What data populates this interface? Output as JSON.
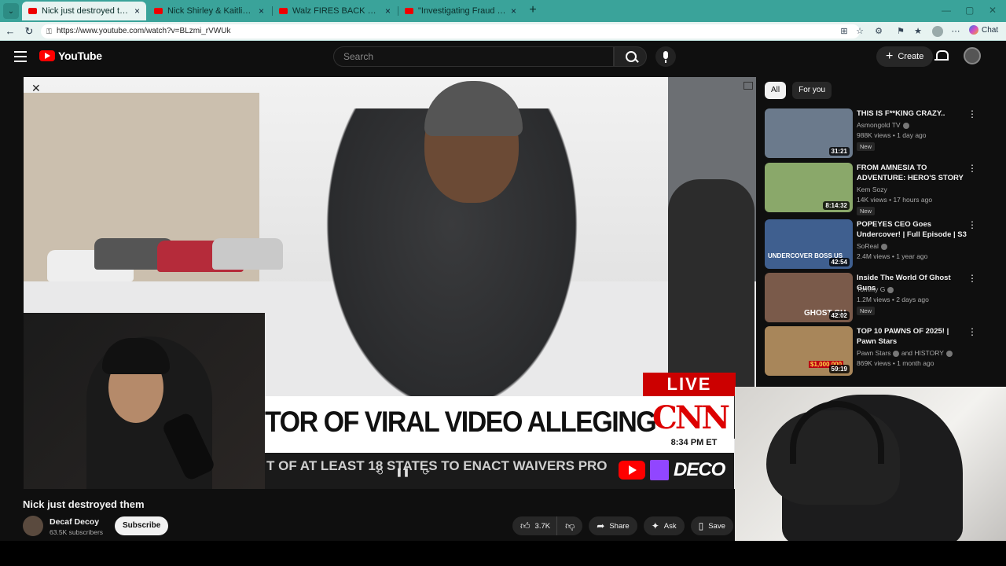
{
  "browser": {
    "tabs": [
      {
        "title": "Nick just destroyed them - YouTube",
        "active": true
      },
      {
        "title": "Nick Shirley & Kaitlin Bennett vs. F",
        "active": false
      },
      {
        "title": "Walz FIRES BACK after Trump team",
        "active": false
      },
      {
        "title": "\"Investigating Fraud Is WHITE SUP",
        "active": false
      }
    ],
    "url": "https://www.youtube.com/watch?v=BLzmi_rVWUk",
    "chat_label": "Chat"
  },
  "youtube": {
    "logo_text": "YouTube",
    "search_placeholder": "Search",
    "create_label": "Create"
  },
  "video": {
    "cnn_live": "LIVE",
    "cnn_headline": "TOR OF VIRAL VIDEO ALLEGING FRAUD IN MN",
    "cnn_logo": "CNN",
    "cnn_time": "8:34 PM ET",
    "ticker": "T OF AT LEAST 18 STATES TO ENACT WAIVERS PRO",
    "ticker_brand": "DECO"
  },
  "chips": [
    "All",
    "For you"
  ],
  "recommendations": [
    {
      "title": "THIS IS F**KING CRAZY..",
      "channel": "Asmongold TV",
      "meta": "988K views • 1 day ago",
      "duration": "31:21",
      "new": true,
      "thumb_color": "#6b7a8c"
    },
    {
      "title": "FROM AMNESIA TO ADVENTURE: HERO'S STORY ...",
      "channel": "Kem Sozy",
      "meta": "14K views • 17 hours ago",
      "duration": "8:14:32",
      "new": true,
      "thumb_color": "#8aa86a"
    },
    {
      "title": "POPEYES CEO Goes Undercover! | Full Episode | S3 ...",
      "channel": "SoReal",
      "meta": "2.4M views • 1 year ago",
      "duration": "42:54",
      "new": false,
      "thumb_color": "#3f5f8f"
    },
    {
      "title": "Inside The World Of Ghost Guns",
      "channel": "Tommy G",
      "meta": "1.2M views • 2 days ago",
      "duration": "42:02",
      "new": true,
      "thumb_color": "#7a5a4a"
    },
    {
      "title": "TOP 10 PAWNS OF 2025! | Pawn Stars",
      "channel": "Pawn Stars",
      "channel_extra": "and HISTORY",
      "meta": "869K views • 1 month ago",
      "duration": "59:19",
      "new": false,
      "thumb_color": "#a8865a"
    }
  ],
  "thumb_texts": [
    "UNDERCOVER BOSS US",
    "GHOST GU",
    "$1,000,000"
  ],
  "watch": {
    "title": "Nick just destroyed them",
    "channel": "Decaf Decoy",
    "subscribers": "63.5K subscribers",
    "subscribe_label": "Subscribe",
    "likes": "3.7K",
    "share_label": "Share",
    "ask_label": "Ask",
    "save_label": "Save"
  }
}
